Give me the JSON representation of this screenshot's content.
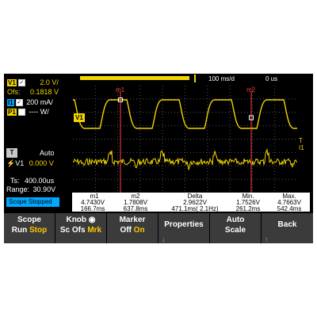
{
  "top": {
    "timebase": "100 ms/d",
    "delay": "0 us"
  },
  "channels": {
    "v1": {
      "badge": "V1",
      "value": "2.0 V/",
      "offset_label": "Ofs:",
      "offset": "0.1818 V"
    },
    "i1": {
      "badge": "I1",
      "value": "200 mA/"
    },
    "p1": {
      "badge": "P1",
      "value": "---- W/"
    }
  },
  "trigger": {
    "badge": "T",
    "mode": "Auto",
    "source": "V1",
    "level": "0.000 V"
  },
  "acq": {
    "ts_label": "Ts:",
    "ts_value": "400.00us",
    "range_label": "Range:",
    "range_value": "30.90V"
  },
  "status": "Scope Stopped",
  "plot": {
    "marker1_label": "m1",
    "marker2_label": "m2",
    "trace_label": "V1",
    "right_labels": [
      "T",
      "I1"
    ],
    "colors": {
      "voltage": "#f2d500",
      "marker": "#ff4040",
      "grid": "#555555"
    }
  },
  "measurements": {
    "headers": [
      "m1",
      "m2",
      "Delta",
      "Min.",
      "Max."
    ],
    "row1": [
      "4.7430V",
      "1.7808V",
      "2.9622V",
      "1.7526V",
      "4.7663V"
    ],
    "row2": [
      "166.7ms",
      "637.8ms",
      "471.1ms( 2.1Hz)",
      "261.2ms",
      "542.4ms"
    ]
  },
  "softkeys": [
    {
      "title": "Scope",
      "options": [
        "Run",
        "Stop"
      ],
      "selected": 1
    },
    {
      "title": "Knob",
      "options": [
        "Sc",
        "Ofs",
        "Mrk"
      ],
      "selected": 2
    },
    {
      "title": "Marker",
      "options": [
        "Off",
        "On"
      ],
      "selected": 1
    },
    {
      "title": "Properties"
    },
    {
      "title": "Auto",
      "subtitle": "Scale"
    },
    {
      "title": "Back"
    }
  ]
}
